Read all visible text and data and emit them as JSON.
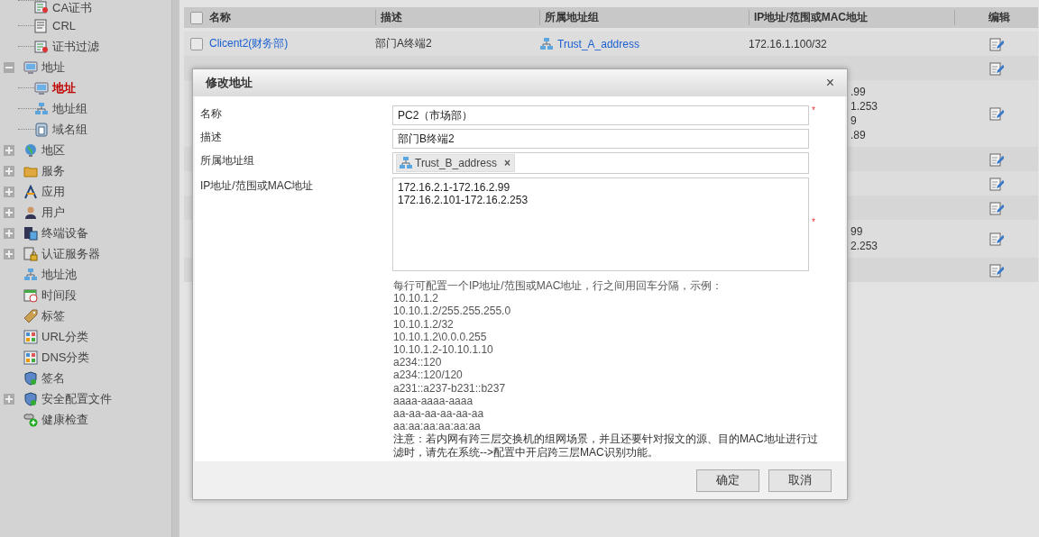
{
  "sidebar": {
    "items": [
      {
        "children": [
          {
            "label": "CA证书",
            "selected": false
          },
          {
            "label": "CRL",
            "selected": false
          },
          {
            "label": "证书过滤",
            "selected": false
          }
        ]
      },
      {
        "label": "地址",
        "expanded": true,
        "selected": false,
        "children": [
          {
            "label": "地址",
            "selected": true
          },
          {
            "label": "地址组",
            "selected": false
          },
          {
            "label": "域名组",
            "selected": false
          }
        ]
      },
      {
        "label": "地区",
        "expanded": false,
        "selected": false
      },
      {
        "label": "服务",
        "expanded": false,
        "selected": false
      },
      {
        "label": "应用",
        "expanded": false,
        "selected": false
      },
      {
        "label": "用户",
        "expanded": false,
        "selected": false
      },
      {
        "label": "终端设备",
        "expanded": false,
        "selected": false
      },
      {
        "label": "认证服务器",
        "expanded": false,
        "selected": false
      },
      {
        "label": "地址池",
        "selected": false
      },
      {
        "label": "时间段",
        "selected": false
      },
      {
        "label": "标签",
        "selected": false
      },
      {
        "label": "URL分类",
        "selected": false
      },
      {
        "label": "DNS分类",
        "selected": false
      },
      {
        "label": "签名",
        "selected": false
      },
      {
        "label": "安全配置文件",
        "expanded": false,
        "selected": false
      },
      {
        "label": "健康检查",
        "selected": false
      }
    ]
  },
  "table": {
    "select_all": {
      "checked": false
    },
    "columns": [
      "名称",
      "描述",
      "所属地址组",
      "IP地址/范围或MAC地址",
      "编辑"
    ],
    "rows": [
      {
        "checked": false,
        "name": "Clicent2(财务部)",
        "description": "部门A终端2",
        "group": "Trust_A_address",
        "ip": [
          "172.16.1.100/32"
        ]
      },
      {},
      {
        "ip": [
          ".99",
          "1.253",
          "9",
          ".89"
        ]
      },
      {},
      {},
      {},
      {
        "ip": [
          "99",
          "2.253"
        ]
      },
      {}
    ]
  },
  "dialog": {
    "title": "修改地址",
    "close": "×",
    "fields": [
      {
        "kind": "input",
        "label": "名称",
        "value": "PC2（市场部）",
        "required_mark": "*"
      },
      {
        "kind": "input",
        "label": "描述",
        "value": "部门B终端2"
      },
      {
        "kind": "tags",
        "label": "所属地址组",
        "tags": [
          {
            "label": "Trust_B_address",
            "remove": "×"
          }
        ]
      },
      {
        "kind": "textarea",
        "label": "IP地址/范围或MAC地址",
        "lines": [
          "172.16.2.1-172.16.2.99",
          "172.16.2.101-172.16.2.253"
        ],
        "required_mark": "*"
      }
    ],
    "hint": "每行可配置一个IP地址/范围或MAC地址，行之间用回车分隔，示例：",
    "examples": [
      "10.10.1.2",
      "10.10.1.2/255.255.255.0",
      "10.10.1.2/32",
      "10.10.1.2\\0.0.0.255",
      "10.10.1.2-10.10.1.10",
      "a234::120",
      "a234::120/120",
      "a231::a237-b231::b237",
      "aaaa-aaaa-aaaa",
      "aa-aa-aa-aa-aa-aa",
      "aa:aa:aa:aa:aa:aa"
    ],
    "note": "注意：若内网有跨三层交换机的组网场景，并且还要针对报文的源、目的MAC地址进行过滤时，请先在系统-->配置中开启跨三层MAC识别功能。",
    "buttons": [
      "确定",
      "取消"
    ]
  }
}
